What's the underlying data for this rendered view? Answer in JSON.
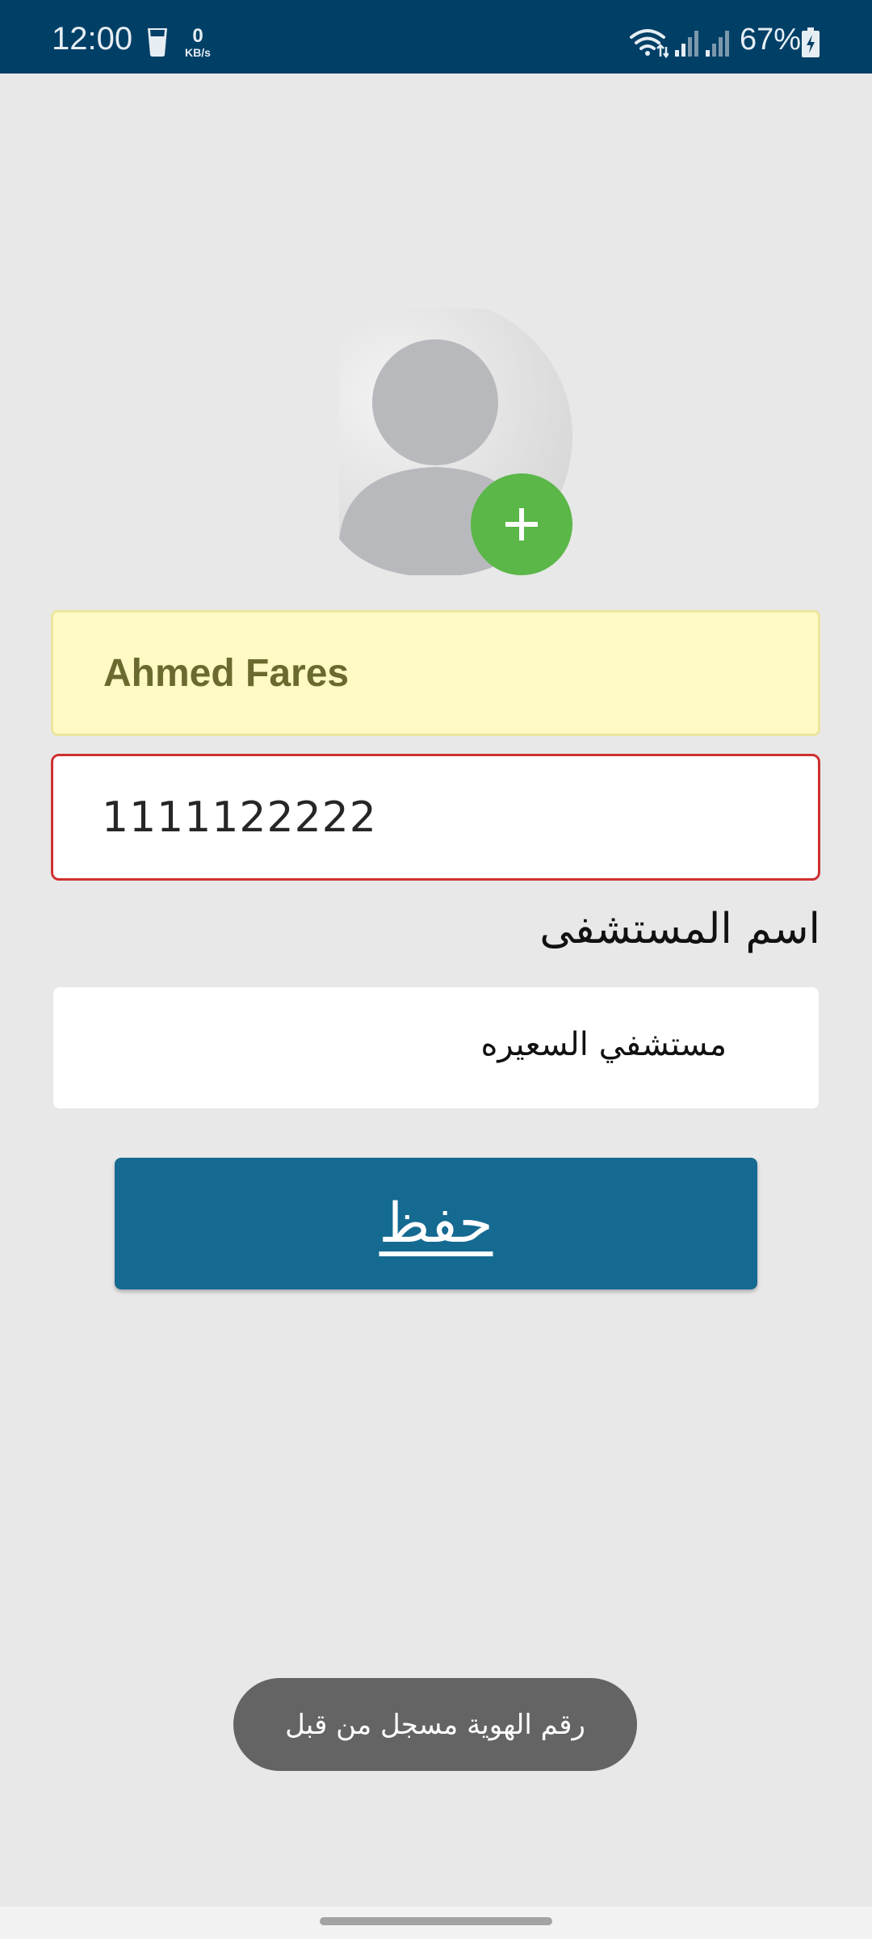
{
  "status_bar": {
    "time": "12:00",
    "net_speed_value": "0",
    "net_speed_unit": "KB/s",
    "battery_percent": "67%"
  },
  "form": {
    "name_value": "Ahmed Fares",
    "id_value": "1111122222",
    "hospital_label": "اسم المستشفى",
    "hospital_value": "مستشفي السعيره"
  },
  "actions": {
    "save_label": "حفظ"
  },
  "toast": {
    "message": "رقم الهوية مسجل من قبل"
  },
  "colors": {
    "status_bar": "#003f66",
    "background": "#e8e8e8",
    "name_field_bg": "#fff9c4",
    "id_field_border_error": "#cf3030",
    "save_button": "#156a92",
    "add_photo_button": "#5ab748",
    "toast_bg": "#646464"
  },
  "icons": [
    "water-cup-icon",
    "wifi-icon",
    "cell-signal-icon",
    "battery-charging-icon",
    "avatar-placeholder-icon",
    "plus-icon"
  ]
}
